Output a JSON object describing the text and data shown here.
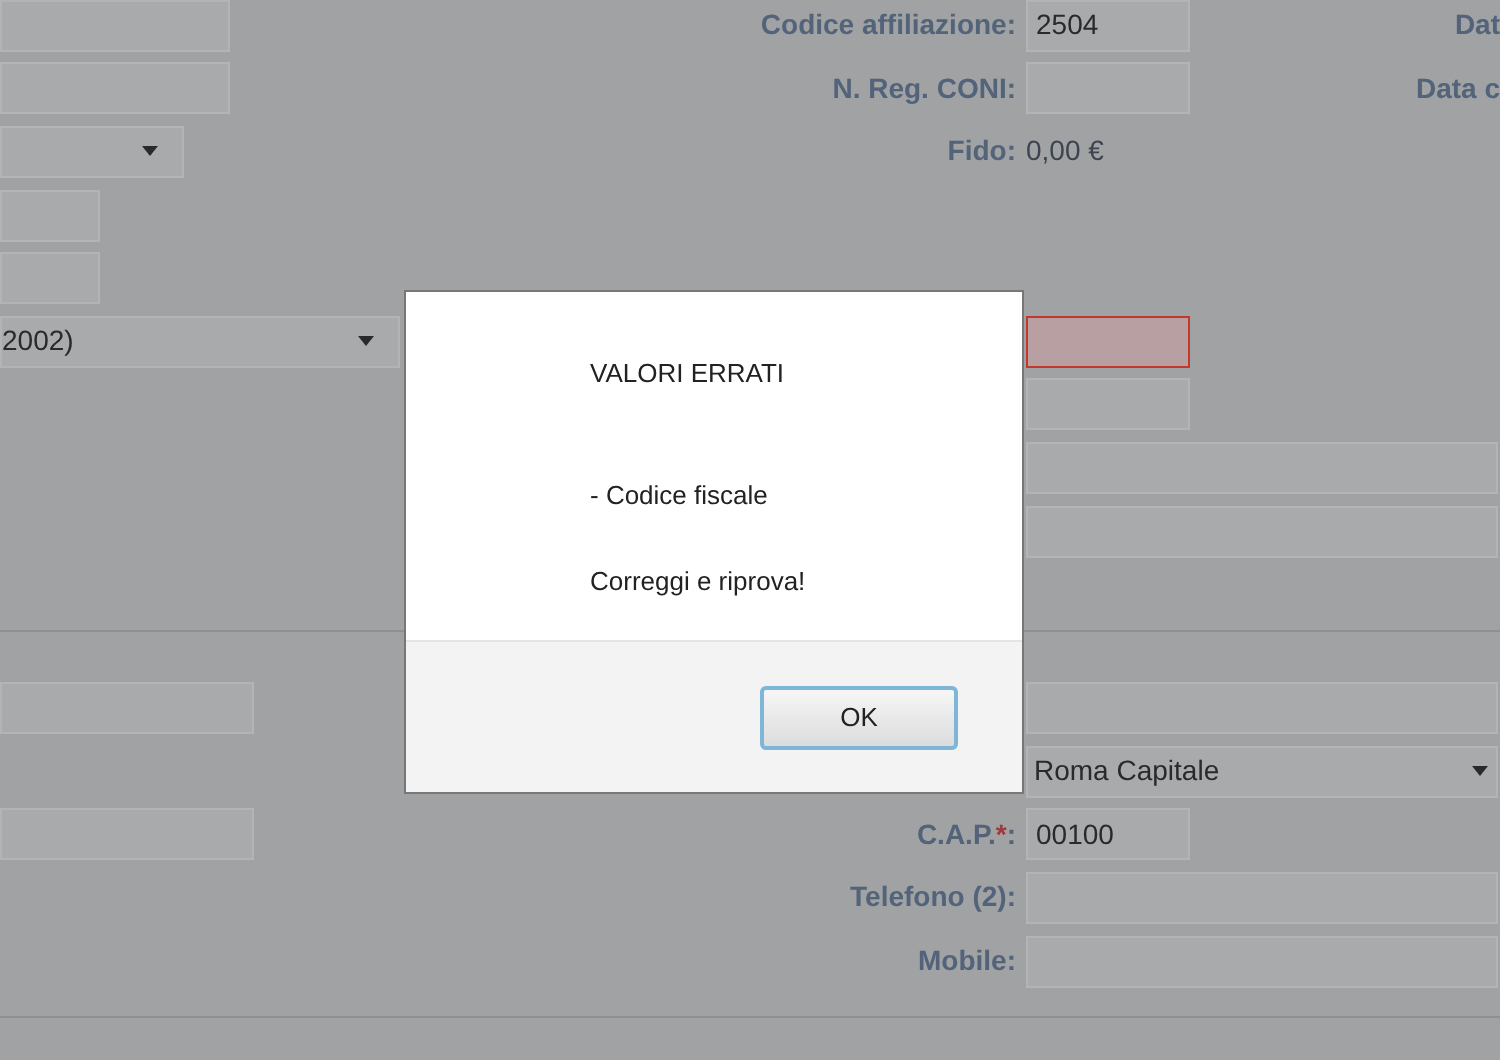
{
  "form": {
    "sections": [
      {
        "rows": [
          {
            "left": {
              "kind": "input"
            },
            "label": "Codice affiliazione:",
            "field": {
              "kind": "input",
              "value": "2504",
              "invalid": false
            },
            "right_label": "Dat"
          },
          {
            "left": {
              "kind": "input"
            },
            "label": "N. Reg. CONI:",
            "field": {
              "kind": "input",
              "invalid": false
            },
            "right_label": "Data c"
          },
          {
            "left": {
              "kind": "select"
            },
            "label": "Fido:",
            "field": {
              "kind": "text",
              "value": "0,00 €"
            }
          },
          {
            "left": {
              "kind": "input"
            }
          },
          {
            "left": {
              "kind": "input"
            }
          },
          {
            "left": {
              "kind": "select",
              "value": "2002)"
            },
            "field": {
              "kind": "input",
              "invalid": true
            }
          },
          {
            "field": {
              "kind": "input",
              "invalid": false
            }
          },
          {
            "field": {
              "kind": "wide",
              "invalid": false
            }
          },
          {
            "field": {
              "kind": "wide",
              "invalid": false
            }
          }
        ]
      },
      {
        "rows": [
          {
            "left": {
              "kind": "input"
            },
            "field": {
              "kind": "wide",
              "invalid": false
            }
          },
          {
            "field": {
              "kind": "select",
              "value": "Roma Capitale"
            }
          },
          {
            "left": {
              "kind": "input"
            },
            "label": "C.A.P.",
            "mark": "*",
            "colon": ":",
            "field": {
              "kind": "input",
              "value": "00100",
              "invalid": false
            }
          },
          {
            "label": "Telefono (2):",
            "field": {
              "kind": "wide",
              "invalid": false
            }
          },
          {
            "label": "Mobile:",
            "field": {
              "kind": "wide",
              "invalid": false
            }
          }
        ]
      }
    ]
  },
  "dialog": {
    "title": "VALORI ERRATI",
    "errors": [
      "- Codice fiscale"
    ],
    "message": "Correggi e riprova!",
    "button": "OK"
  }
}
